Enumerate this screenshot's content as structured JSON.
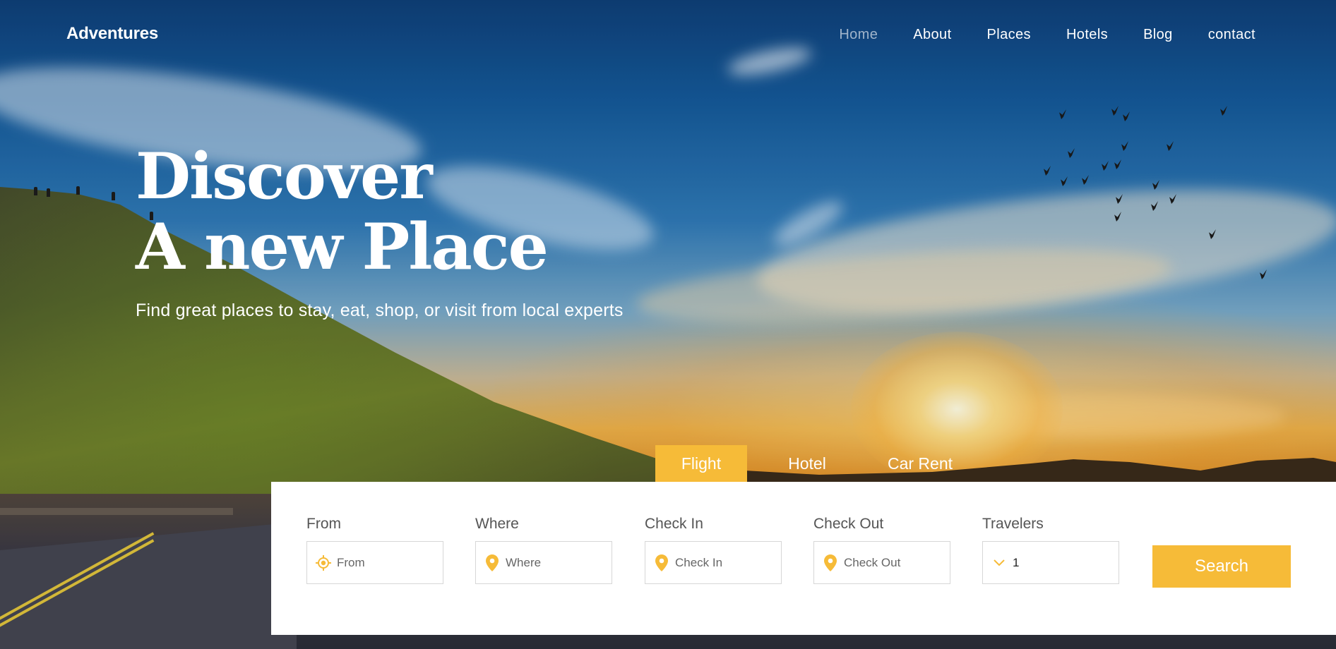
{
  "header": {
    "logo": "Adventures",
    "nav": [
      "Home",
      "About",
      "Places",
      "Hotels",
      "Blog",
      "contact"
    ],
    "active_nav": "Home"
  },
  "hero": {
    "headline_line1": "Discover",
    "headline_line2": "A new Place",
    "subtitle": "Find great places to stay, eat, shop, or visit from local experts"
  },
  "booking": {
    "tabs": [
      "Flight",
      "Hotel",
      "Car Rent"
    ],
    "active_tab": "Flight",
    "fields": [
      {
        "label": "From",
        "placeholder": "From",
        "icon": "crosshair-icon"
      },
      {
        "label": "Where",
        "placeholder": "Where",
        "icon": "map-pin-icon"
      },
      {
        "label": "Check In",
        "placeholder": "Check In",
        "icon": "map-pin-icon"
      },
      {
        "label": "Check Out",
        "placeholder": "Check Out",
        "icon": "map-pin-icon"
      }
    ],
    "travelers": {
      "label": "Travelers",
      "value": "1",
      "icon": "chevron-down-icon"
    },
    "search_label": "Search"
  },
  "colors": {
    "accent": "#f6bb38",
    "panel": "#ffffff",
    "label_text": "#555555"
  }
}
